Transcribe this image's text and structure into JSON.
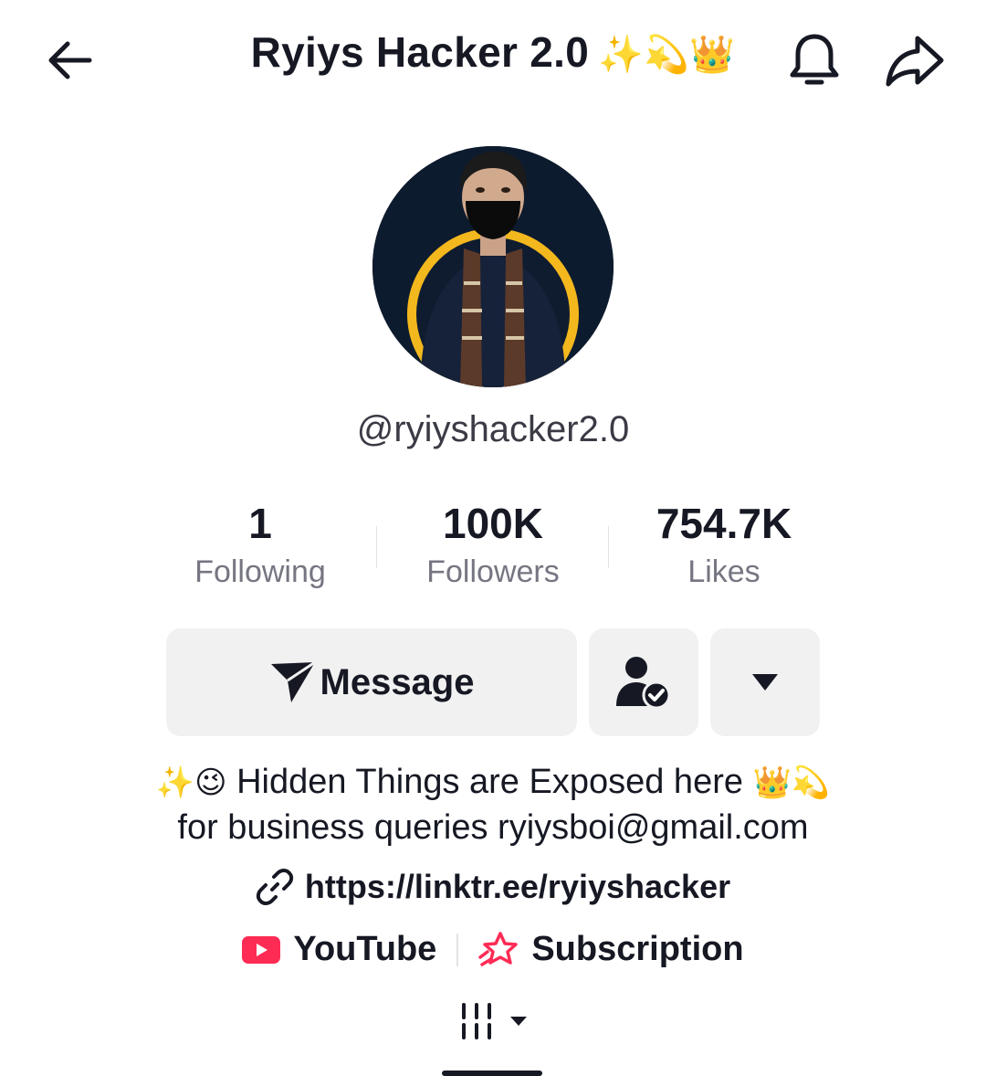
{
  "header": {
    "title": "Ryiys Hacker 2.0",
    "title_emoji": "✨💫👑"
  },
  "profile": {
    "username": "@ryiyshacker2.0",
    "avatar_ring_color": "#f3b81d"
  },
  "stats": [
    {
      "value": "1",
      "label": "Following"
    },
    {
      "value": "100K",
      "label": "Followers"
    },
    {
      "value": "754.7K",
      "label": "Likes"
    }
  ],
  "actions": {
    "message_label": "Message",
    "followed_icon": "user-check-icon",
    "more_icon": "caret-down-icon"
  },
  "bio": {
    "line1_emoji_lead": "✨😉",
    "line1_text": "Hidden Things are Exposed here",
    "line1_emoji_trail": "👑💫",
    "line2_text": "for business queries ryiysboi@gmail.com"
  },
  "link": {
    "url": "https://linktr.ee/ryiyshacker"
  },
  "social": {
    "youtube_label": "YouTube",
    "subscription_label": "Subscription",
    "youtube_color": "#fe2c55"
  }
}
